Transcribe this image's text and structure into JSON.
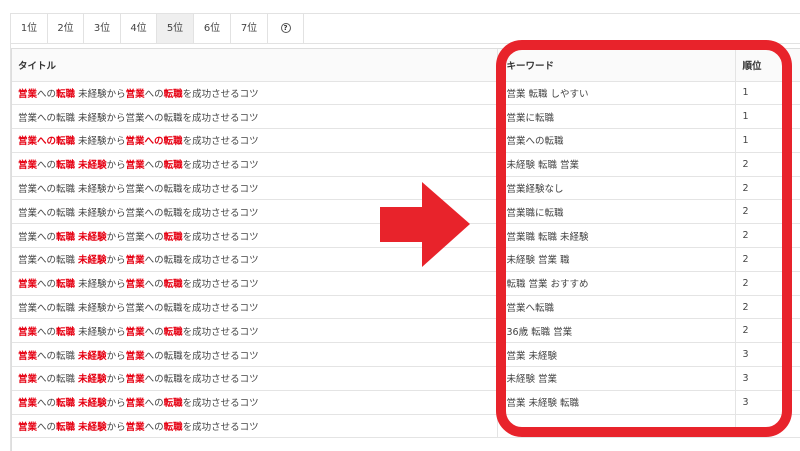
{
  "tabs": [
    {
      "label": "1位",
      "active": false
    },
    {
      "label": "2位",
      "active": false
    },
    {
      "label": "3位",
      "active": false
    },
    {
      "label": "4位",
      "active": false
    },
    {
      "label": "5位",
      "active": true
    },
    {
      "label": "6位",
      "active": false
    },
    {
      "label": "7位",
      "active": false
    },
    {
      "label": "?",
      "icon": "help-icon",
      "active": false
    }
  ],
  "table": {
    "headers": {
      "title": "タイトル",
      "keyword": "キーワード",
      "rank": "順位"
    },
    "title_text": "営業への転職 未経験から営業への転職を成功させるコツ",
    "rows": [
      {
        "title": [
          [
            "営業",
            "h"
          ],
          [
            "への",
            "n"
          ],
          [
            "転職",
            "h"
          ],
          [
            " 未経験から",
            "n"
          ],
          [
            "営業",
            "h"
          ],
          [
            "への",
            "n"
          ],
          [
            "転職",
            "h"
          ],
          [
            "を成功させるコツ",
            "n"
          ]
        ],
        "keyword": "営業 転職 しやすい",
        "rank": "1"
      },
      {
        "title": [
          [
            "営業への転職 未経験から営業への転職を成功させるコツ",
            "n"
          ]
        ],
        "keyword": "営業に転職",
        "rank": "1"
      },
      {
        "title": [
          [
            "営業への転職",
            "h"
          ],
          [
            " 未経験から",
            "n"
          ],
          [
            "営業への転職",
            "h"
          ],
          [
            "を成功させるコツ",
            "n"
          ]
        ],
        "keyword": "営業への転職",
        "rank": "1"
      },
      {
        "title": [
          [
            "営業",
            "h"
          ],
          [
            "への",
            "n"
          ],
          [
            "転職",
            "h"
          ],
          [
            " ",
            "n"
          ],
          [
            "未経験",
            "h"
          ],
          [
            "から",
            "n"
          ],
          [
            "営業",
            "h"
          ],
          [
            "への",
            "n"
          ],
          [
            "転職",
            "h"
          ],
          [
            "を成功させるコツ",
            "n"
          ]
        ],
        "keyword": "未経験 転職 営業",
        "rank": "2"
      },
      {
        "title": [
          [
            "営業への転職 未経験から営業への転職を成功させるコツ",
            "n"
          ]
        ],
        "keyword": "営業経験なし",
        "rank": "2"
      },
      {
        "title": [
          [
            "営業への転職 未経験から営業への転職を成功させるコツ",
            "n"
          ]
        ],
        "keyword": "営業職に転職",
        "rank": "2"
      },
      {
        "title": [
          [
            "営業への",
            "n"
          ],
          [
            "転職",
            "h"
          ],
          [
            " ",
            "n"
          ],
          [
            "未経験",
            "h"
          ],
          [
            "から営業への",
            "n"
          ],
          [
            "転職",
            "h"
          ],
          [
            "を成功させるコツ",
            "n"
          ]
        ],
        "keyword": "営業職 転職 未経験",
        "rank": "2"
      },
      {
        "title": [
          [
            "営業への転職 ",
            "n"
          ],
          [
            "未経験",
            "h"
          ],
          [
            "から",
            "n"
          ],
          [
            "営業",
            "h"
          ],
          [
            "への転職を成功させるコツ",
            "n"
          ]
        ],
        "keyword": "未経験 営業 職",
        "rank": "2"
      },
      {
        "title": [
          [
            "営業",
            "h"
          ],
          [
            "への",
            "n"
          ],
          [
            "転職",
            "h"
          ],
          [
            " 未経験から",
            "n"
          ],
          [
            "営業",
            "h"
          ],
          [
            "への",
            "n"
          ],
          [
            "転職",
            "h"
          ],
          [
            "を成功させるコツ",
            "n"
          ]
        ],
        "keyword": "転職 営業 おすすめ",
        "rank": "2"
      },
      {
        "title": [
          [
            "営業への転職 未経験から営業への転職を成功させるコツ",
            "n"
          ]
        ],
        "keyword": "営業へ転職",
        "rank": "2"
      },
      {
        "title": [
          [
            "営業",
            "h"
          ],
          [
            "への",
            "n"
          ],
          [
            "転職",
            "h"
          ],
          [
            " 未経験から",
            "n"
          ],
          [
            "営業",
            "h"
          ],
          [
            "への",
            "n"
          ],
          [
            "転職",
            "h"
          ],
          [
            "を成功させるコツ",
            "n"
          ]
        ],
        "keyword": "36歳 転職 営業",
        "rank": "2"
      },
      {
        "title": [
          [
            "営業",
            "h"
          ],
          [
            "への転職 ",
            "n"
          ],
          [
            "未経験",
            "h"
          ],
          [
            "から",
            "n"
          ],
          [
            "営業",
            "h"
          ],
          [
            "への転職を成功させるコツ",
            "n"
          ]
        ],
        "keyword": "営業 未経験",
        "rank": "3"
      },
      {
        "title": [
          [
            "営業",
            "h"
          ],
          [
            "への転職 ",
            "n"
          ],
          [
            "未経験",
            "h"
          ],
          [
            "から",
            "n"
          ],
          [
            "営業",
            "h"
          ],
          [
            "への転職を成功させるコツ",
            "n"
          ]
        ],
        "keyword": "未経験 営業",
        "rank": "3"
      },
      {
        "title": [
          [
            "営業",
            "h"
          ],
          [
            "への",
            "n"
          ],
          [
            "転職",
            "h"
          ],
          [
            " ",
            "n"
          ],
          [
            "未経験",
            "h"
          ],
          [
            "から",
            "n"
          ],
          [
            "営業",
            "h"
          ],
          [
            "への",
            "n"
          ],
          [
            "転職",
            "h"
          ],
          [
            "を成功させるコツ",
            "n"
          ]
        ],
        "keyword": "営業 未経験 転職",
        "rank": "3"
      },
      {
        "title": [
          [
            "営業",
            "h"
          ],
          [
            "への",
            "n"
          ],
          [
            "転職",
            "h"
          ],
          [
            " ",
            "n"
          ],
          [
            "未経験",
            "h"
          ],
          [
            "から",
            "n"
          ],
          [
            "営業",
            "h"
          ],
          [
            "への",
            "n"
          ],
          [
            "転職",
            "h"
          ],
          [
            "を成功させるコツ",
            "n"
          ]
        ],
        "keyword": "",
        "rank": ""
      }
    ]
  },
  "colors": {
    "highlight": "#e60012",
    "frame": "#e8232b",
    "arrow": "#e8232b"
  }
}
